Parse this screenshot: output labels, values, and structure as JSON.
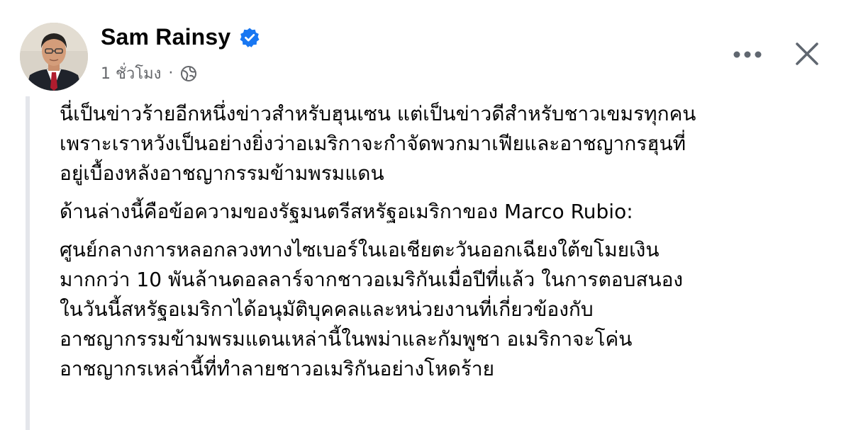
{
  "post": {
    "author": "Sam Rainsy",
    "verified": true,
    "timestamp": "1 ชั่วโมง",
    "separator": "·",
    "audience_icon": "globe-icon",
    "more_icon": "more-horizontal-icon",
    "close_icon": "close-icon",
    "paragraphs": [
      {
        "lines": [
          "นี่เป็นข่าวร้ายอีกหนึ่งข่าวสำหรับฮุนเซน แต่เป็นข่าวดีสำหรับชาวเขมรทุกคน",
          "เพราะเราหวังเป็นอย่างยิ่งว่าอเมริกาจะกำจัดพวกมาเฟียและอาชญากรฮุนที่",
          "อยู่เบื้องหลังอาชญากรรมข้ามพรมแดน"
        ]
      },
      {
        "lines": [
          "ด้านล่างนี้คือข้อความของรัฐมนตรีสหรัฐอเมริกาของ Marco Rubio:"
        ]
      },
      {
        "lines": [
          "ศูนย์กลางการหลอกลวงทางไซเบอร์ในเอเชียตะวันออกเฉียงใต้ขโมยเงิน",
          "มากกว่า 10 พันล้านดอลลาร์จากชาวอเมริกันเมื่อปีที่แล้ว ในการตอบสนอง",
          "ในวันนี้สหรัฐอเมริกาได้อนุมัติบุคคลและหน่วยงานที่เกี่ยวข้องกับ",
          "อาชญากรรมข้ามพรมแดนเหล่านี้ในพม่าและกัมพูชา อเมริกาจะโค่น",
          "อาชญากรเหล่านี้ที่ทำลายชาวอเมริกันอย่างโหดร้าย"
        ]
      }
    ]
  },
  "colors": {
    "text": "#050505",
    "secondary_text": "#65676b",
    "verified_blue": "#1877f2",
    "rule": "#e4e6eb"
  }
}
